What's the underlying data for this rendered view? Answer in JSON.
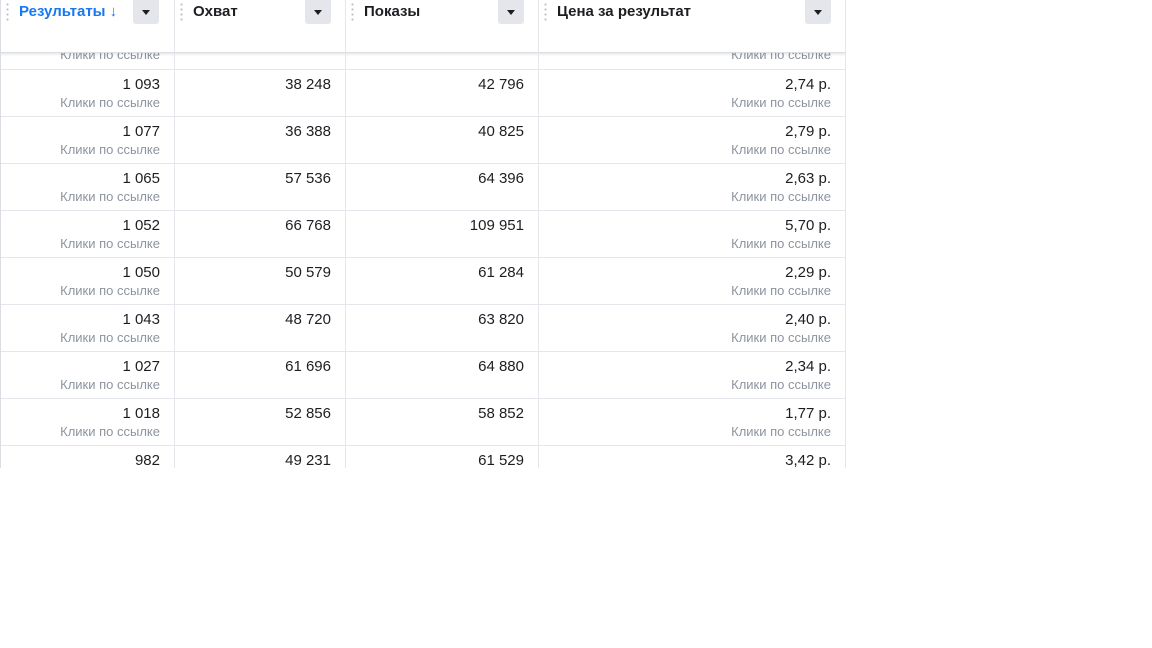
{
  "columns": [
    {
      "label": "Результаты ↓",
      "sorted": true
    },
    {
      "label": "Охват",
      "sorted": false
    },
    {
      "label": "Показы",
      "sorted": false
    },
    {
      "label": "Цена за результат",
      "sorted": false
    }
  ],
  "partial_top_row": {
    "result_sub": "Клики по ссылке",
    "cost_sub": "Клики по ссылке"
  },
  "rows": [
    {
      "result": "1 093",
      "result_sub": "Клики по ссылке",
      "reach": "38 248",
      "impressions": "42 796",
      "cost": "2,74 р.",
      "cost_sub": "Клики по ссылке"
    },
    {
      "result": "1 077",
      "result_sub": "Клики по ссылке",
      "reach": "36 388",
      "impressions": "40 825",
      "cost": "2,79 р.",
      "cost_sub": "Клики по ссылке"
    },
    {
      "result": "1 065",
      "result_sub": "Клики по ссылке",
      "reach": "57 536",
      "impressions": "64 396",
      "cost": "2,63 р.",
      "cost_sub": "Клики по ссылке"
    },
    {
      "result": "1 052",
      "result_sub": "Клики по ссылке",
      "reach": "66 768",
      "impressions": "109 951",
      "cost": "5,70 р.",
      "cost_sub": "Клики по ссылке"
    },
    {
      "result": "1 050",
      "result_sub": "Клики по ссылке",
      "reach": "50 579",
      "impressions": "61 284",
      "cost": "2,29 р.",
      "cost_sub": "Клики по ссылке"
    },
    {
      "result": "1 043",
      "result_sub": "Клики по ссылке",
      "reach": "48 720",
      "impressions": "63 820",
      "cost": "2,40 р.",
      "cost_sub": "Клики по ссылке"
    },
    {
      "result": "1 027",
      "result_sub": "Клики по ссылке",
      "reach": "61 696",
      "impressions": "64 880",
      "cost": "2,34 р.",
      "cost_sub": "Клики по ссылке"
    },
    {
      "result": "1 018",
      "result_sub": "Клики по ссылке",
      "reach": "52 856",
      "impressions": "58 852",
      "cost": "1,77 р.",
      "cost_sub": "Клики по ссылке"
    },
    {
      "result": "982",
      "result_sub": "",
      "reach": "49 231",
      "impressions": "61 529",
      "cost": "3,42 р.",
      "cost_sub": ""
    }
  ],
  "colors": {
    "sorted_header": "#1877f2",
    "text": "#1c1e21",
    "muted": "#8d949e",
    "border": "#e4e6eb",
    "button_bg": "#e4e6eb"
  },
  "icons": {
    "sort": "arrow-down-icon",
    "dropdown": "caret-down-icon",
    "grip": "drag-handle-icon"
  }
}
